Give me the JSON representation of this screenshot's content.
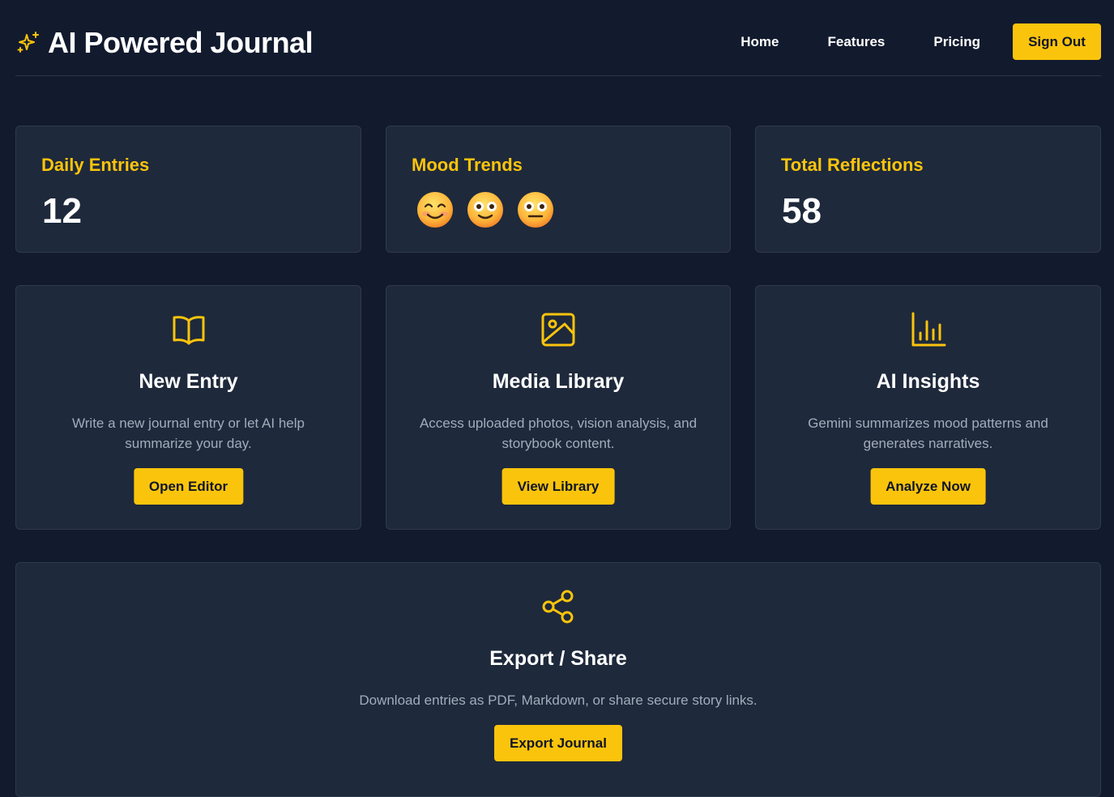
{
  "header": {
    "title": "AI Powered Journal",
    "nav": [
      "Home",
      "Features",
      "Pricing"
    ],
    "sign_out": "Sign Out"
  },
  "stats": [
    {
      "label": "Daily Entries",
      "value": "12"
    },
    {
      "label": "Mood Trends",
      "moods": [
        "smiling-face-emoji",
        "wide-eyed-face-emoji",
        "neutral-face-emoji"
      ]
    },
    {
      "label": "Total Reflections",
      "value": "58"
    }
  ],
  "features": [
    {
      "icon": "book-open-icon",
      "title": "New Entry",
      "description": "Write a new journal entry or let AI help summarize your day.",
      "button": "Open Editor"
    },
    {
      "icon": "image-icon",
      "title": "Media Library",
      "description": "Access uploaded photos, vision analysis, and storybook content.",
      "button": "View Library"
    },
    {
      "icon": "bar-chart-icon",
      "title": "AI Insights",
      "description": "Gemini summarizes mood patterns and generates narratives.",
      "button": "Analyze Now"
    }
  ],
  "export": {
    "icon": "share-icon",
    "title": "Export / Share",
    "description": "Download entries as PDF, Markdown, or share secure story links.",
    "button": "Export Journal"
  },
  "colors": {
    "background": "#121a2e",
    "card": "#1e293b",
    "accent": "#fbc40c",
    "muted_text": "#a2acbb"
  }
}
